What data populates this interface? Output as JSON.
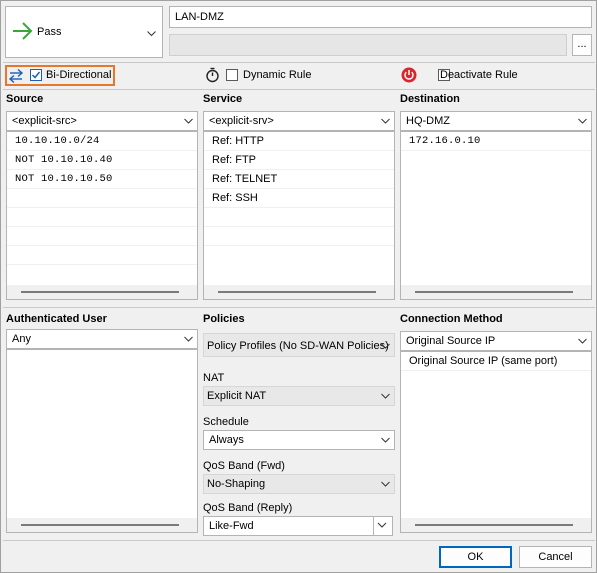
{
  "rule": {
    "action_label": "Pass",
    "name": "LAN-DMZ",
    "comment": "",
    "more_label": "..."
  },
  "options": {
    "bidirectional": {
      "label": "Bi-Directional",
      "checked": true
    },
    "dynamic_rule": {
      "label": "Dynamic Rule",
      "checked": false
    },
    "deactivate_rule": {
      "label": "Deactivate Rule",
      "checked": false
    }
  },
  "source": {
    "title": "Source",
    "selected": "<explicit-src>",
    "items": [
      "10.10.10.0/24",
      "NOT 10.10.10.40",
      "NOT 10.10.10.50"
    ]
  },
  "service": {
    "title": "Service",
    "selected": "<explicit-srv>",
    "items": [
      "Ref: HTTP",
      "Ref: FTP",
      "Ref: TELNET",
      "Ref: SSH"
    ]
  },
  "destination": {
    "title": "Destination",
    "selected": "HQ-DMZ",
    "items": [
      "172.16.0.10"
    ]
  },
  "auth_user": {
    "title": "Authenticated User",
    "selected": "Any"
  },
  "policies": {
    "title": "Policies",
    "policy_profiles": "Policy Profiles (No SD-WAN Policies)",
    "nat_label": "NAT",
    "nat_value": "Explicit NAT",
    "schedule_label": "Schedule",
    "schedule_value": "Always",
    "qos_fwd_label": "QoS Band (Fwd)",
    "qos_fwd_value": "No-Shaping",
    "qos_reply_label": "QoS Band (Reply)",
    "qos_reply_value": "Like-Fwd"
  },
  "connection": {
    "title": "Connection Method",
    "selected": "Original Source IP",
    "items": [
      "Original Source IP (same port)"
    ]
  },
  "buttons": {
    "ok": "OK",
    "cancel": "Cancel"
  },
  "colors": {
    "pass_arrow": "#3aa63a",
    "bidir_highlight": "#e8772e",
    "bidir_icon": "#1a5fb4",
    "deactivate_icon": "#d9262c"
  }
}
